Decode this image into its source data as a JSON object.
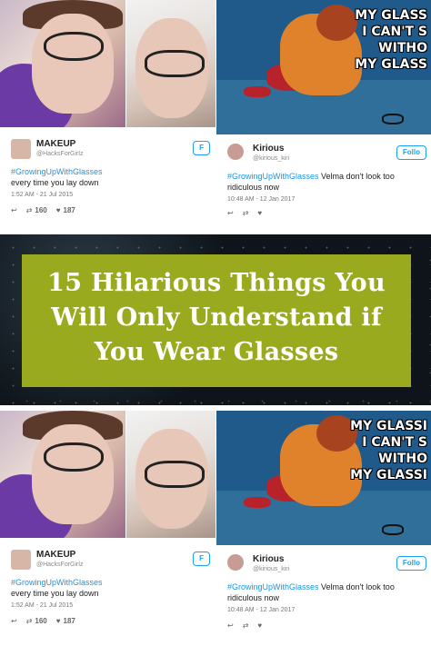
{
  "banner": {
    "title_line1": "15 Hilarious Things You",
    "title_line2": "Will Only Understand if",
    "title_line3": "You Wear Glasses",
    "box_color": "#9aaa1e"
  },
  "cards": {
    "left": {
      "display_name": "MAKEUP",
      "handle": "@HacksForGirlz",
      "follow_label": "F",
      "hashtag": "#GrowingUpWithGlasses",
      "text": "every time you lay down",
      "timestamp": "1:52 AM - 21 Jul 2015",
      "reply_icon": "reply-icon",
      "retweet_count": "160",
      "like_count": "187"
    },
    "right": {
      "display_name": "Kirious",
      "handle": "@kirious_kiri",
      "follow_label": "Follo",
      "hashtag": "#GrowingUpWithGlasses",
      "text": " Velma don't look too ridiculous now",
      "timestamp": "10:48 AM - 12 Jan 2017",
      "caption": "MY GLASS\nI CAN'T S\nWITHO\nMY GLASS"
    },
    "right_bottom": {
      "caption": "MY GLASSI\nI CAN'T S\nWITHO\nMY GLASSI"
    }
  }
}
